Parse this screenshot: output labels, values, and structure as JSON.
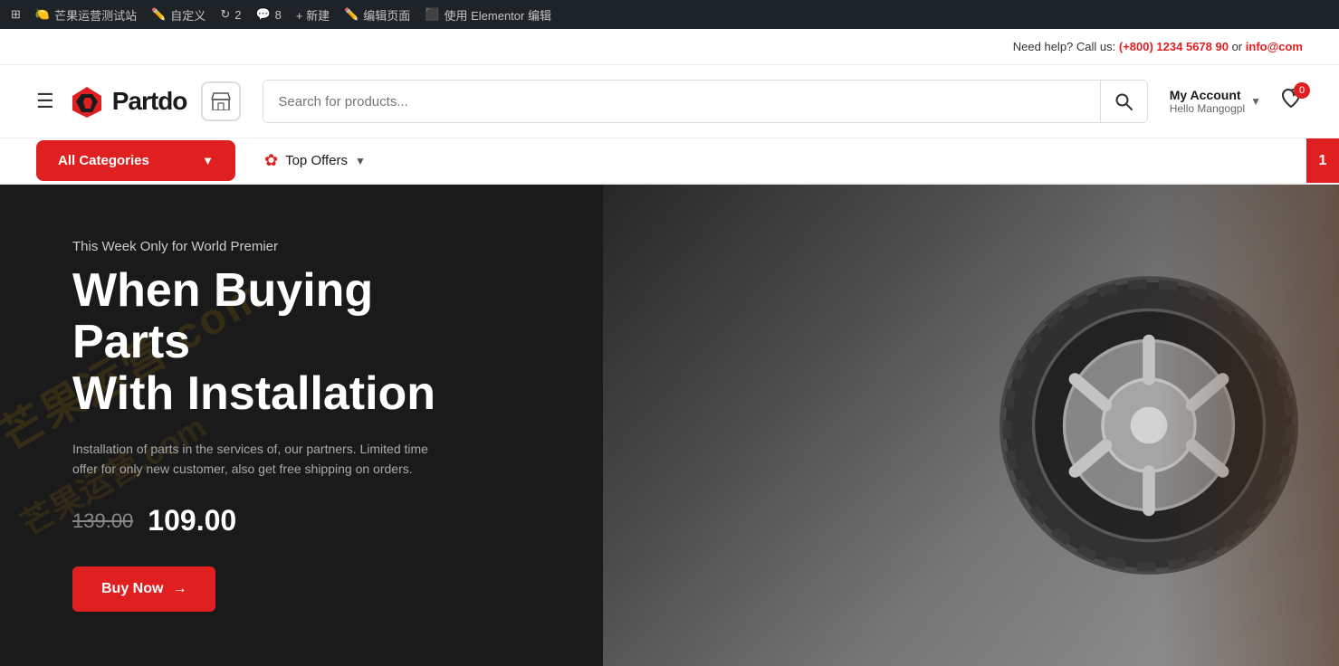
{
  "adminBar": {
    "siteName": "芒果运营测试站",
    "customize": "自定义",
    "revisions": "2",
    "comments": "8",
    "new": "+ 新建",
    "editPage": "编辑页面",
    "elementorEdit": "使用 Elementor 编辑"
  },
  "topBar": {
    "needHelp": "Need help? Call us:",
    "phone": "(+800) 1234 5678 90",
    "or": "or",
    "email": "info@com"
  },
  "header": {
    "logoText": "Partdo",
    "searchPlaceholder": "Search for products...",
    "myAccount": "My Account",
    "hello": "Hello Mangogpl",
    "wishlistCount": "0"
  },
  "nav": {
    "allCategories": "All Categories",
    "topOffers": "Top Offers",
    "notificationCount": "1"
  },
  "hero": {
    "subtitle": "This Week Only for World Premier",
    "title": "When Buying Parts\nWith Installation",
    "description": "Installation of parts in the services of, our partners. Limited time offer for only new customer, also get free shipping on orders.",
    "oldPrice": "139.00",
    "newPrice": "109.00",
    "buyNow": "Buy Now",
    "arrow": "→"
  }
}
